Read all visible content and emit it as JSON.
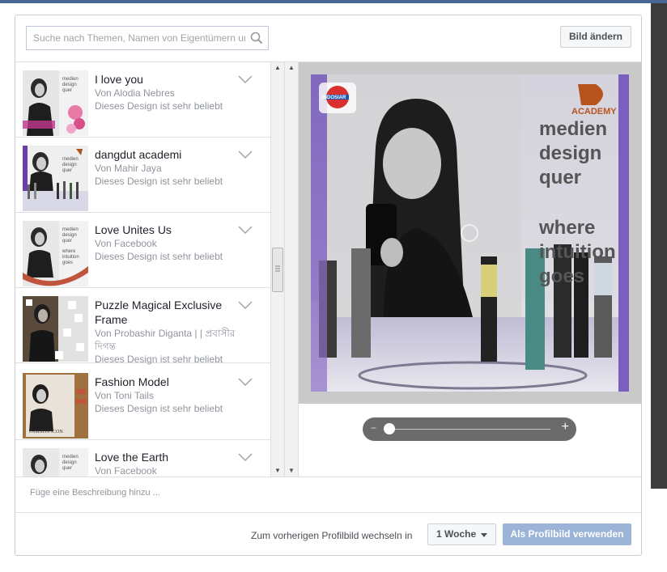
{
  "search": {
    "placeholder": "Suche nach Themen, Namen von Eigentümern und"
  },
  "header": {
    "change_button": "Bild ändern"
  },
  "frames": [
    {
      "title": "I love you",
      "by": "Von Alodia Nebres",
      "popularity": "Dieses Design ist sehr beliebt"
    },
    {
      "title": "dangdut academi",
      "by": "Von Mahir Jaya",
      "popularity": "Dieses Design ist sehr beliebt"
    },
    {
      "title": "Love Unites Us",
      "by": "Von Facebook",
      "popularity": "Dieses Design ist sehr beliebt"
    },
    {
      "title": "Puzzle Magical Exclusive Frame",
      "by": "Von Probashir Diganta | | প্রবাসীর দিগন্ত",
      "popularity": "Dieses Design ist sehr beliebt"
    },
    {
      "title": "Fashion Model",
      "by": "Von Toni Tails",
      "popularity": "Dieses Design ist sehr beliebt"
    },
    {
      "title": "Love the Earth",
      "by": "Von Facebook",
      "popularity": ""
    }
  ],
  "thumb_text": {
    "line1": "medien",
    "line2": "design",
    "line3": "quer",
    "line4": "where",
    "line5": "intuition",
    "line6": "goes",
    "fashion": "FASHION ICON"
  },
  "preview": {
    "line1": "medien",
    "line2": "design",
    "line3": "quer",
    "line4": "where",
    "line5": "intuition",
    "line6": "goes",
    "logo_left": "INDOSIAR",
    "logo_right": "ACADEMY"
  },
  "zoom": {
    "minus": "−",
    "plus": "+",
    "level": 0.0
  },
  "description": {
    "placeholder": "Füge eine Beschreibung hinzu ..."
  },
  "footer": {
    "label": "Zum vorherigen Profilbild wechseln in",
    "duration": "1 Woche",
    "use_button": "Als Profilbild verwenden"
  },
  "colors": {
    "accent": "#4a6796",
    "primary_button_disabled": "#9cb4d8",
    "muted_text": "#90949c"
  }
}
